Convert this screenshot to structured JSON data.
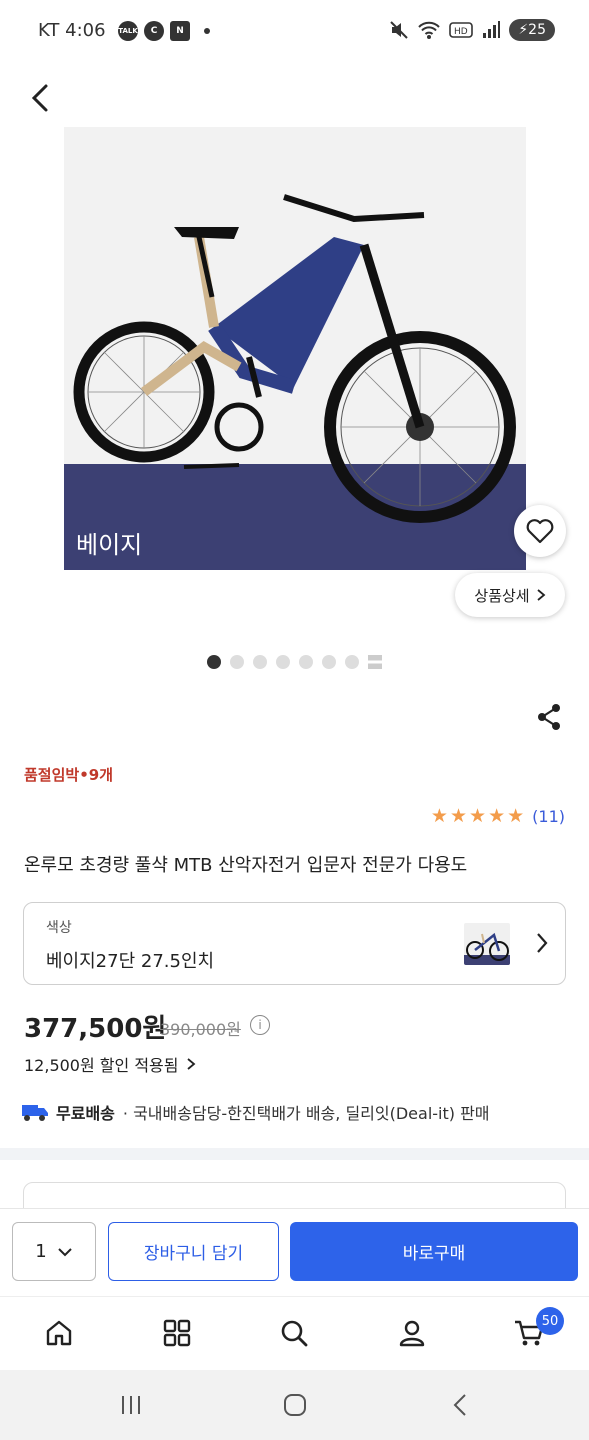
{
  "status_bar": {
    "carrier_time": "KT 4:06",
    "notifications": [
      "TALK",
      "C",
      "N"
    ],
    "battery": "25"
  },
  "product": {
    "image_caption": "베이지",
    "detail_button": "상품상세",
    "page_count": 7,
    "current_page": 1,
    "stock_notice": "품절임박•9개",
    "rating_stars": 5,
    "review_count": "(11)",
    "title": "온루모 초경량 풀샥 MTB 산악자전거 입문자 전문가 다용도"
  },
  "option": {
    "label": "색상",
    "value": "베이지27단 27.5인치"
  },
  "pricing": {
    "price": "377,500원",
    "original_price": "390,000원",
    "discount_text": "12,500원 할인 적용됨"
  },
  "shipping": {
    "free_label": "무료배송",
    "detail": "· 국내배송담당-한진택배가 배송, 딜리잇(Deal-it) 판매"
  },
  "buy_bar": {
    "quantity": "1",
    "cart_label": "장바구니 담기",
    "buy_label": "바로구매"
  },
  "tab_bar": {
    "cart_badge": "50"
  },
  "colors": {
    "accent": "#2d63ea",
    "stock_red": "#c0392b",
    "star": "#f39c4b",
    "frame_blue": "#3c4073"
  }
}
